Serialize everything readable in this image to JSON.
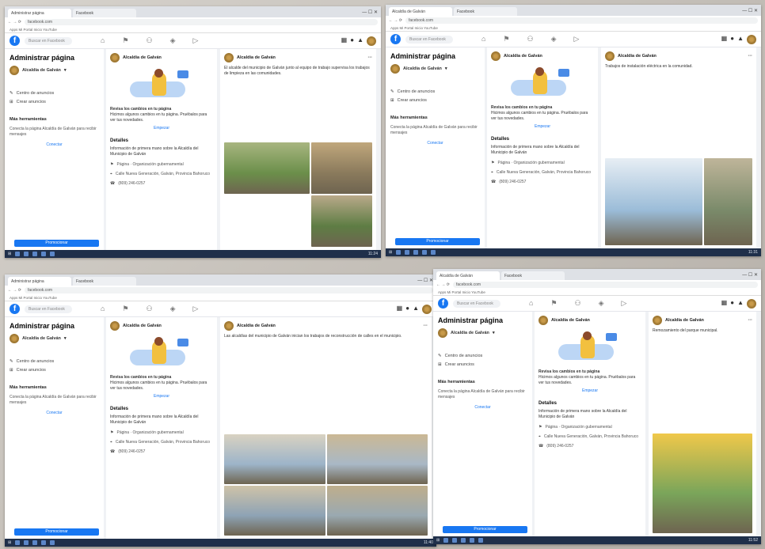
{
  "screens": [
    {
      "tabs": [
        "Administrar página",
        "Facebook"
      ],
      "address": "facebook.com",
      "bookmarks": "Apps  Mi Portal  Inicio  YouTube",
      "search": "Buscar en Facebook",
      "left": {
        "title": "Administrar página",
        "page_name": "Alcaldía de Galván",
        "items": [
          "Centro de anuncios",
          "Crear anuncios"
        ],
        "section": "Más herramientas",
        "box_text": "Conecta la página Alcaldía de Galván para recibir mensajes",
        "box_link": "Conectar",
        "promote": "Promocionar"
      },
      "center": {
        "page_name": "Alcaldía de Galván",
        "review_title": "Revisa los cambios en tu página",
        "review_text": "Hicimos algunos cambios en tu página. Pruébalos para ver tus novedades.",
        "review_link": "Empezar",
        "details_title": "Detalles",
        "details_text": "Información de primera mano sobre la Alcaldía del Municipio de Galván",
        "rows": [
          "Página · Organización gubernamental",
          "Calle Nueva Generación, Galván, Provincia Bahoruco",
          "(809) 246-0257"
        ]
      },
      "post": {
        "author": "Alcaldía de Galván",
        "text": "El alcalde del municipio de Galván junto al equipo de trabajo supervisa los trabajos de limpieza en las comunidades."
      },
      "taskbar_time": "11:24"
    },
    {
      "tabs": [
        "Alcaldía de Galván",
        "Facebook"
      ],
      "address": "facebook.com",
      "bookmarks": "Apps  Mi Portal  Inicio  YouTube",
      "search": "Buscar en Facebook",
      "left": {
        "title": "Administrar página",
        "page_name": "Alcaldía de Galván",
        "items": [
          "Centro de anuncios",
          "Crear anuncios"
        ],
        "section": "Más herramientas",
        "box_text": "Conecta la página Alcaldía de Galván para recibir mensajes",
        "box_link": "Conectar",
        "promote": "Promocionar"
      },
      "center": {
        "page_name": "Alcaldía de Galván",
        "review_title": "Revisa los cambios en tu página",
        "review_text": "Hicimos algunos cambios en tu página. Pruébalos para ver tus novedades.",
        "review_link": "Empezar",
        "details_title": "Detalles",
        "details_text": "Información de primera mano sobre la Alcaldía del Municipio de Galván",
        "rows": [
          "Página · Organización gubernamental",
          "Calle Nueva Generación, Galván, Provincia Bahoruco",
          "(809) 246-0257"
        ]
      },
      "post": {
        "author": "Alcaldía de Galván",
        "text": "Trabajos de instalación eléctrica en la comunidad."
      },
      "taskbar_time": "11:31"
    },
    {
      "tabs": [
        "Administrar página",
        "Facebook"
      ],
      "address": "facebook.com",
      "bookmarks": "Apps  Mi Portal  Inicio  YouTube",
      "search": "Buscar en Facebook",
      "left": {
        "title": "Administrar página",
        "page_name": "Alcaldía de Galván",
        "items": [
          "Centro de anuncios",
          "Crear anuncios"
        ],
        "section": "Más herramientas",
        "box_text": "Conecta la página Alcaldía de Galván para recibir mensajes",
        "box_link": "Conectar",
        "promote": "Promocionar"
      },
      "center": {
        "page_name": "Alcaldía de Galván",
        "review_title": "Revisa los cambios en tu página",
        "review_text": "Hicimos algunos cambios en tu página. Pruébalos para ver tus novedades.",
        "review_link": "Empezar",
        "details_title": "Detalles",
        "details_text": "Información de primera mano sobre la Alcaldía del Municipio de Galván",
        "rows": [
          "Página · Organización gubernamental",
          "Calle Nueva Generación, Galván, Provincia Bahoruco",
          "(809) 246-0257"
        ]
      },
      "post": {
        "author": "Alcaldía de Galván",
        "text": "Las alcaldías del municipio de Galván inician los trabajos de reconstrucción de calles en el municipio."
      },
      "taskbar_time": "11:40"
    },
    {
      "tabs": [
        "Alcaldía de Galván",
        "Facebook"
      ],
      "address": "facebook.com",
      "bookmarks": "Apps  Mi Portal  Inicio  YouTube",
      "search": "Buscar en Facebook",
      "left": {
        "title": "Administrar página",
        "page_name": "Alcaldía de Galván",
        "items": [
          "Centro de anuncios",
          "Crear anuncios"
        ],
        "section": "Más herramientas",
        "box_text": "Conecta la página Alcaldía de Galván para recibir mensajes",
        "box_link": "Conectar",
        "promote": "Promocionar"
      },
      "center": {
        "page_name": "Alcaldía de Galván",
        "review_title": "Revisa los cambios en tu página",
        "review_text": "Hicimos algunos cambios en tu página. Pruébalos para ver tus novedades.",
        "review_link": "Empezar",
        "details_title": "Detalles",
        "details_text": "Información de primera mano sobre la Alcaldía del Municipio de Galván",
        "rows": [
          "Página · Organización gubernamental",
          "Calle Nueva Generación, Galván, Provincia Bahoruco",
          "(809) 246-0257"
        ]
      },
      "post": {
        "author": "Alcaldía de Galván",
        "text": "Remozamiento del parque municipal."
      },
      "taskbar_time": "11:52"
    }
  ]
}
